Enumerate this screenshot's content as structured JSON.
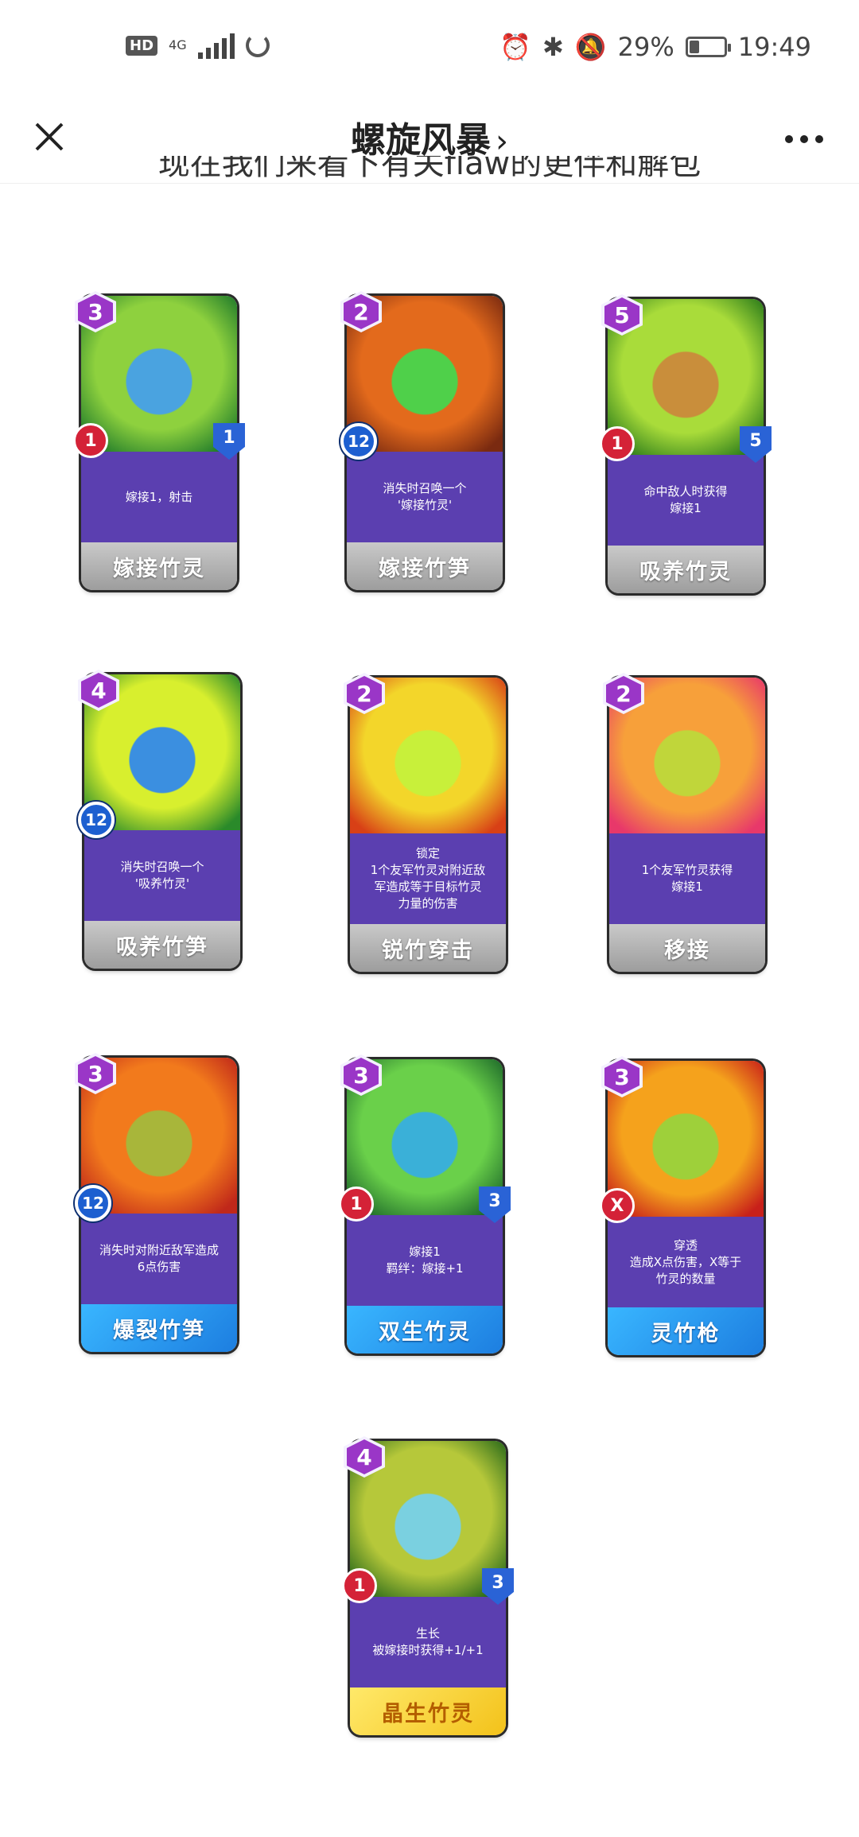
{
  "status_bar": {
    "hd": "HD",
    "network": "4G",
    "battery_percent": "29%",
    "battery_level": 0.29,
    "time": "19:49"
  },
  "nav": {
    "title": "螺旋风暴",
    "chevron": "›",
    "close_icon": "close-icon",
    "more_icon": "more-icon"
  },
  "cut_text": "现在我们来看下有关flaw的更伴和解包",
  "cards": [
    {
      "cost": "3",
      "name": "嫁接竹灵",
      "desc": "嫁接1，射击",
      "badge": "attack",
      "badge_value": "1",
      "health": "1",
      "style": "grey",
      "art": [
        "#1f7a2a",
        "#8ed13e",
        "#4aa3e0"
      ]
    },
    {
      "cost": "2",
      "name": "嫁接竹笋",
      "desc": "消失时召唤一个\n'嫁接竹灵'",
      "badge": "timer",
      "badge_value": "12",
      "health": "",
      "style": "grey",
      "art": [
        "#7a2a10",
        "#e36a1c",
        "#4fd04a"
      ]
    },
    {
      "cost": "5",
      "name": "吸养竹灵",
      "desc": "命中敌人时获得\n嫁接1",
      "badge": "attack",
      "badge_value": "1",
      "health": "5",
      "style": "grey",
      "art": [
        "#2a7a1a",
        "#a9dc3a",
        "#c98e3b"
      ]
    },
    {
      "cost": "4",
      "name": "吸养竹笋",
      "desc": "消失时召唤一个\n'吸养竹灵'",
      "badge": "timer",
      "badge_value": "12",
      "health": "",
      "style": "grey",
      "art": [
        "#2a8a2a",
        "#d8ef2e",
        "#3b8fe0"
      ]
    },
    {
      "cost": "2",
      "name": "锐竹穿击",
      "desc": "锁定\n1个友军竹灵对附近敌\n军造成等于目标竹灵\n力量的伤害",
      "badge": "",
      "badge_value": "",
      "health": "",
      "style": "grey",
      "art": [
        "#d84016",
        "#f3d62a",
        "#c8f03a"
      ]
    },
    {
      "cost": "2",
      "name": "移接",
      "desc": "1个友军竹灵获得\n嫁接1",
      "badge": "",
      "badge_value": "",
      "health": "",
      "style": "grey",
      "art": [
        "#e8386a",
        "#f7a03a",
        "#c0d63a"
      ]
    },
    {
      "cost": "3",
      "name": "爆裂竹笋",
      "desc": "消失时对附近敌军造成\n6点伤害",
      "badge": "timer",
      "badge_value": "12",
      "health": "",
      "style": "blue",
      "art": [
        "#c0281a",
        "#f27a1c",
        "#a8b63a"
      ]
    },
    {
      "cost": "3",
      "name": "双生竹灵",
      "desc": "嫁接1\n羁绊：嫁接+1",
      "badge": "attack",
      "badge_value": "1",
      "health": "3",
      "style": "blue",
      "art": [
        "#1e6a2a",
        "#6ad04a",
        "#3ab0d8"
      ]
    },
    {
      "cost": "3",
      "name": "灵竹枪",
      "desc": "穿透\n造成X点伤害，X等于\n竹灵的数量",
      "badge": "attack",
      "badge_value": "X",
      "health": "",
      "style": "blue",
      "art": [
        "#c8201a",
        "#f5a21c",
        "#9ed03a"
      ]
    },
    {
      "cost": "4",
      "name": "晶生竹灵",
      "desc": "生长\n被嫁接时获得+1/+1",
      "badge": "attack",
      "badge_value": "1",
      "health": "3",
      "style": "gold",
      "art": [
        "#2a6a1a",
        "#b6c83a",
        "#7ad0e0"
      ]
    }
  ]
}
